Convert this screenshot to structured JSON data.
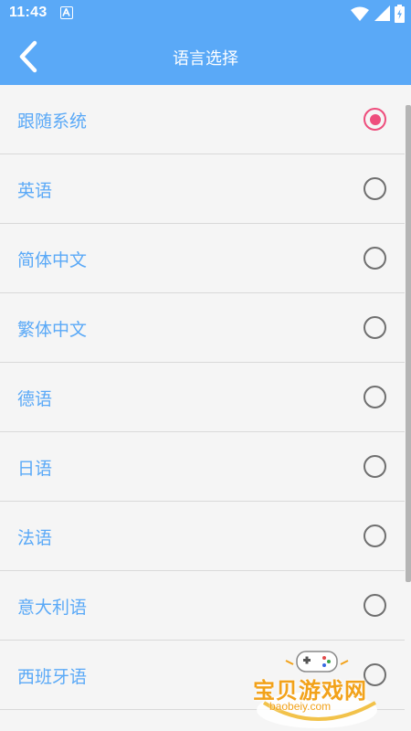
{
  "status_bar": {
    "time": "11:43",
    "icons": [
      "notification-a-icon",
      "wifi-icon",
      "signal-icon",
      "battery-icon"
    ]
  },
  "toolbar": {
    "back_icon": "chevron-left-icon",
    "title": "语言选择"
  },
  "language_list": {
    "items": [
      {
        "label": "跟随系统",
        "selected": true
      },
      {
        "label": "英语",
        "selected": false
      },
      {
        "label": "简体中文",
        "selected": false
      },
      {
        "label": "繁体中文",
        "selected": false
      },
      {
        "label": "德语",
        "selected": false
      },
      {
        "label": "日语",
        "selected": false
      },
      {
        "label": "法语",
        "selected": false
      },
      {
        "label": "意大利语",
        "selected": false
      },
      {
        "label": "西班牙语",
        "selected": false
      }
    ]
  },
  "watermark": {
    "name": "宝贝游戏网",
    "domain": "baobeiy.com"
  },
  "colors": {
    "primary": "#5aa9f7",
    "selected_radio": "#ee4d7c",
    "unselected_radio": "#6f6f6f",
    "background": "#f5f5f5",
    "divider": "#d9d9d9",
    "watermark": "#f2a21a"
  }
}
